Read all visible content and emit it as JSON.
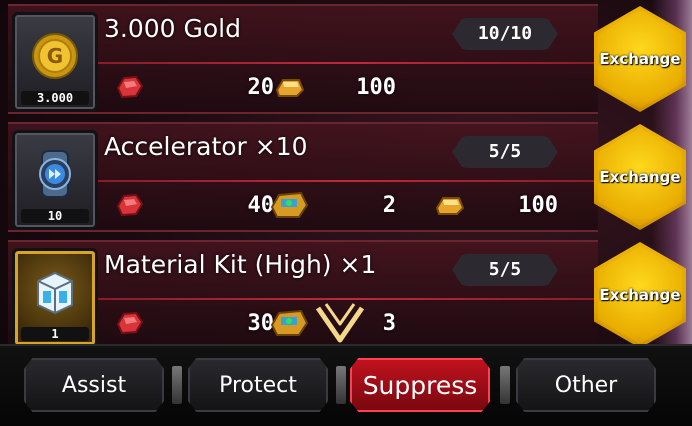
{
  "rows": [
    {
      "title": "3.000 Gold",
      "item_count": "3.000",
      "item_icon": "gold-coin-icon",
      "stock": "10/10",
      "costs": [
        {
          "icon": "red-ore-icon",
          "value": "20"
        },
        {
          "icon": "gold-ingot-icon",
          "value": "100"
        }
      ],
      "button_label": "Exchange"
    },
    {
      "title": "Accelerator ×10",
      "item_count": "10",
      "item_icon": "accelerator-icon",
      "stock": "5/5",
      "costs": [
        {
          "icon": "red-ore-icon",
          "value": "40"
        },
        {
          "icon": "jeweled-chest-icon",
          "value": "2"
        },
        {
          "icon": "gold-ingot-icon",
          "value": "100"
        }
      ],
      "button_label": "Exchange"
    },
    {
      "title": "Material Kit (High) ×1",
      "item_count": "1",
      "item_icon": "material-kit-icon",
      "stock": "5/5",
      "costs": [
        {
          "icon": "red-ore-icon",
          "value": "30"
        },
        {
          "icon": "jeweled-chest-icon",
          "value": "3"
        }
      ],
      "button_label": "Exchange"
    }
  ],
  "tabs": [
    {
      "label": "Assist",
      "active": false
    },
    {
      "label": "Protect",
      "active": false
    },
    {
      "label": "Suppress",
      "active": true
    },
    {
      "label": "Other",
      "active": false
    }
  ],
  "colors": {
    "accent_gold": "#e2a300",
    "active_tab": "#c0121e",
    "divider_red": "#c0283a"
  }
}
